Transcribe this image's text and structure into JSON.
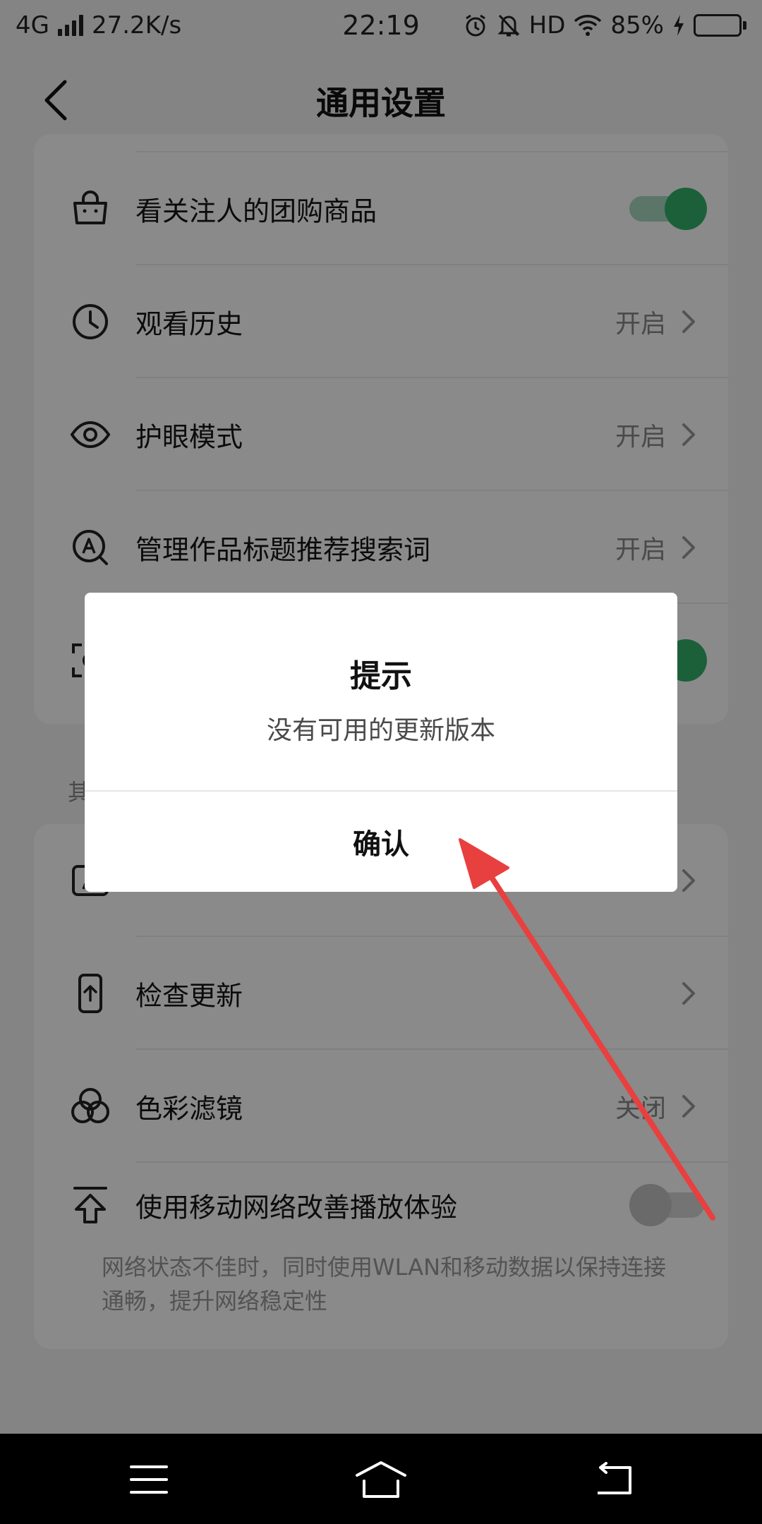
{
  "status_bar": {
    "network": "4G",
    "speed": "27.2K/s",
    "time": "22:19",
    "hd": "HD",
    "battery_percent": "85%",
    "battery_level": 0.85
  },
  "header": {
    "title": "通用设置"
  },
  "settings_group_1": [
    {
      "icon": "shopping-bag-icon",
      "label": "看关注人的团购商品",
      "control": "toggle",
      "on": true
    },
    {
      "icon": "clock-icon",
      "label": "观看历史",
      "value": "开启"
    },
    {
      "icon": "eye-icon",
      "label": "护眼模式",
      "value": "开启"
    },
    {
      "icon": "search-a-icon",
      "label": "管理作品标题推荐搜索词",
      "value": "开启"
    },
    {
      "icon": "scan-icon",
      "label": "",
      "control": "toggle",
      "on": true
    }
  ],
  "section_label": "其",
  "settings_group_2": [
    {
      "icon": "font-a-icon",
      "label": ""
    },
    {
      "icon": "phone-update-icon",
      "label": "检查更新"
    },
    {
      "icon": "color-filter-icon",
      "label": "色彩滤镜",
      "value": "关闭"
    },
    {
      "icon": "upload-arrow-icon",
      "label": "使用移动网络改善播放体验",
      "control": "toggle",
      "on": false,
      "description": "网络状态不佳时，同时使用WLAN和移动数据以保持连接通畅，提升网络稳定性"
    }
  ],
  "dialog": {
    "title": "提示",
    "message": "没有可用的更新版本",
    "confirm_label": "确认"
  },
  "colors": {
    "toggle_on": "#35b26b",
    "annotation_arrow": "#e8403f"
  }
}
